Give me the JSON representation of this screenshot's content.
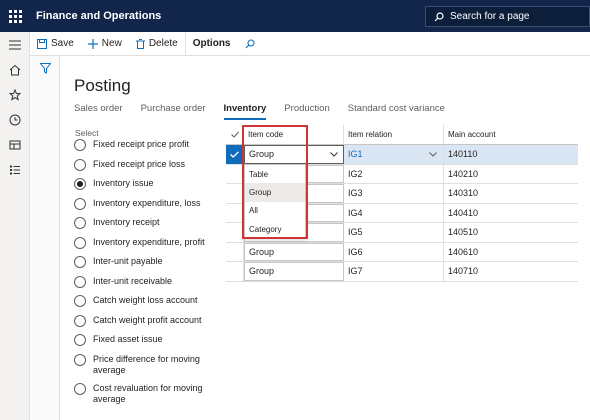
{
  "app": {
    "title": "Finance and Operations",
    "search_placeholder": "Search for a page"
  },
  "actions": {
    "save": "Save",
    "new": "New",
    "delete": "Delete",
    "options": "Options"
  },
  "page": {
    "title": "Posting"
  },
  "tabs": [
    {
      "label": "Sales order",
      "active": false
    },
    {
      "label": "Purchase order",
      "active": false
    },
    {
      "label": "Inventory",
      "active": true
    },
    {
      "label": "Production",
      "active": false
    },
    {
      "label": "Standard cost variance",
      "active": false
    }
  ],
  "select": {
    "label": "Select",
    "options": [
      {
        "label": "Fixed receipt price profit",
        "selected": false
      },
      {
        "label": "Fixed receipt price loss",
        "selected": false
      },
      {
        "label": "Inventory issue",
        "selected": true
      },
      {
        "label": "Inventory expenditure, loss",
        "selected": false
      },
      {
        "label": "Inventory receipt",
        "selected": false
      },
      {
        "label": "Inventory expenditure, profit",
        "selected": false
      },
      {
        "label": "Inter-unit payable",
        "selected": false
      },
      {
        "label": "Inter-unit receivable",
        "selected": false
      },
      {
        "label": "Catch weight loss account",
        "selected": false
      },
      {
        "label": "Catch weight profit account",
        "selected": false
      },
      {
        "label": "Fixed asset issue",
        "selected": false
      },
      {
        "label": "Price difference for moving average",
        "selected": false
      },
      {
        "label": "Cost revaluation for moving average",
        "selected": false
      }
    ]
  },
  "grid": {
    "headers": {
      "item_code": "Item code",
      "item_relation": "Item relation",
      "main_account": "Main account"
    },
    "rows": [
      {
        "item_code": "Group",
        "item_relation": "IG1",
        "main_account": "140110"
      },
      {
        "item_code": "",
        "item_relation": "IG2",
        "main_account": "140210"
      },
      {
        "item_code": "",
        "item_relation": "IG3",
        "main_account": "140310"
      },
      {
        "item_code": "",
        "item_relation": "IG4",
        "main_account": "140410"
      },
      {
        "item_code": "",
        "item_relation": "IG5",
        "main_account": "140510"
      },
      {
        "item_code": "Group",
        "item_relation": "IG6",
        "main_account": "140610"
      },
      {
        "item_code": "Group",
        "item_relation": "IG7",
        "main_account": "140710"
      }
    ]
  },
  "dropdown": {
    "options": [
      "Table",
      "Group",
      "All",
      "Category"
    ],
    "hovered": "Group"
  },
  "colors": {
    "topbar": "#11264a",
    "accent": "#0f6cbd",
    "highlight": "#d13438"
  }
}
